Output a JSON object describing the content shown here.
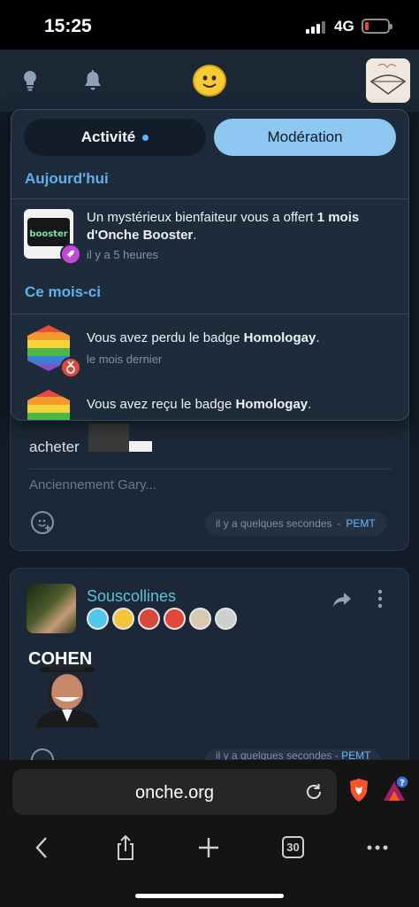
{
  "status_bar": {
    "time": "15:25",
    "network": "4G"
  },
  "header": {
    "icons": [
      "lightbulb-icon",
      "bell-icon",
      "smiley-logo-icon",
      "user-avatar"
    ]
  },
  "notifications": {
    "tabs": [
      {
        "label": "Activité",
        "active": false,
        "unread_dot": true
      },
      {
        "label": "Modération",
        "active": true
      }
    ],
    "sections": [
      {
        "title": "Aujourd'hui",
        "items": [
          {
            "text_prefix": "Un mystérieux bienfaiteur vous a offert ",
            "text_bold": "1 mois d'Onche Booster",
            "text_suffix": ".",
            "time": "il y a 5 heures",
            "icon": "booster-icon",
            "sub_icon": "rocket-icon"
          }
        ]
      },
      {
        "title": "Ce mois-ci",
        "items": [
          {
            "text_prefix": "Vous avez perdu le badge ",
            "text_bold": "Homologay",
            "text_suffix": ".",
            "time": "le mois dernier",
            "icon": "rainbow-badge-icon",
            "sub_icon": "badge-lost-icon"
          },
          {
            "text_prefix": "Vous avez reçu le badge ",
            "text_bold": "Homologay",
            "text_suffix": ".",
            "time": "",
            "icon": "rainbow-badge-icon"
          }
        ]
      }
    ]
  },
  "feed": {
    "post1": {
      "text": "acheter",
      "reply_placeholder": "Anciennement Gary...",
      "time": "il y a quelques secondes",
      "separator": "-",
      "author": "PEMT"
    },
    "post2": {
      "username": "Souscollines",
      "image_caption": "COHEN",
      "time": "il y a quelques secondes",
      "separator": "-",
      "author": "PEMT",
      "badge_colors": [
        "#52c9e8",
        "#f2c53a",
        "#d8463c",
        "#e0473a",
        "#d9c9b0",
        "#cfcfcf"
      ]
    }
  },
  "browser": {
    "url": "onche.org",
    "tab_count": "30",
    "notification_badge": "?"
  },
  "colors": {
    "accent": "#5fb0ec",
    "moderation_tab": "#8ec7f2",
    "username": "#57c2d9"
  }
}
